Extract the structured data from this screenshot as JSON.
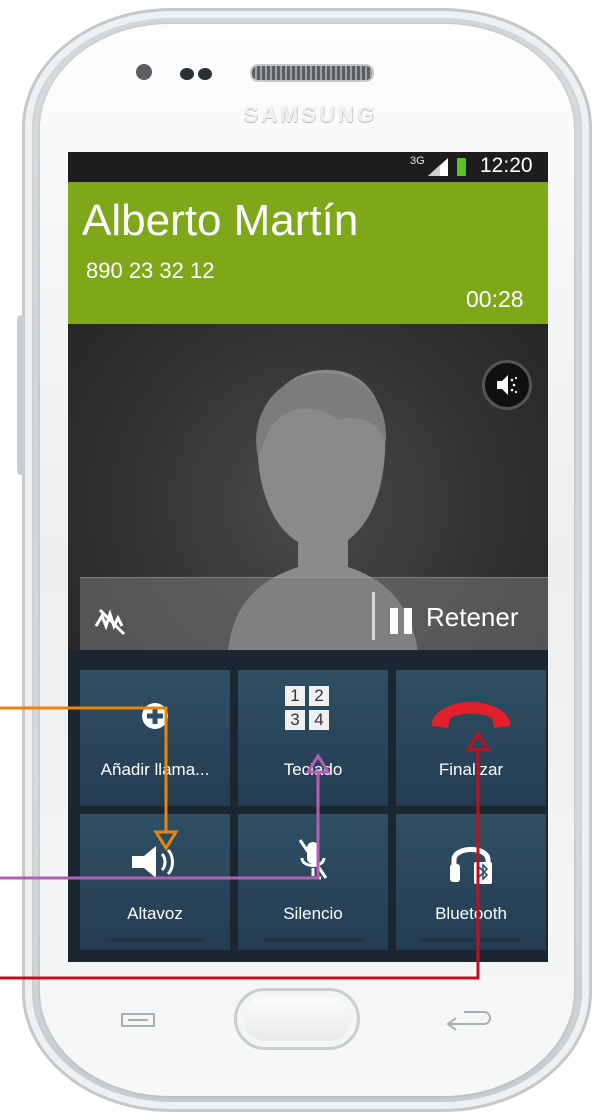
{
  "device": {
    "brand": "SAMSUNG"
  },
  "status_bar": {
    "network": "3G",
    "time": "12:20"
  },
  "call": {
    "caller_name": "Alberto Martín",
    "caller_number": "890 23 32 12",
    "duration": "00:28"
  },
  "controls": {
    "hold_label": "Retener"
  },
  "actions": {
    "add_call": "Añadir llama...",
    "keypad": "Teclado",
    "end_call": "Finalizar",
    "speaker": "Altavoz",
    "mute": "Silencio",
    "bluetooth": "Bluetooth"
  },
  "keypad_digits": {
    "d1": "1",
    "d2": "2",
    "d3": "3",
    "d4": "4"
  },
  "colors": {
    "caller_bar": "#7ea81a",
    "end_call_red": "#e0202a",
    "tile_blue": "#2f4f63",
    "callout_orange": "#e8850e",
    "callout_purple": "#b25fb3",
    "callout_red": "#c0101f"
  }
}
